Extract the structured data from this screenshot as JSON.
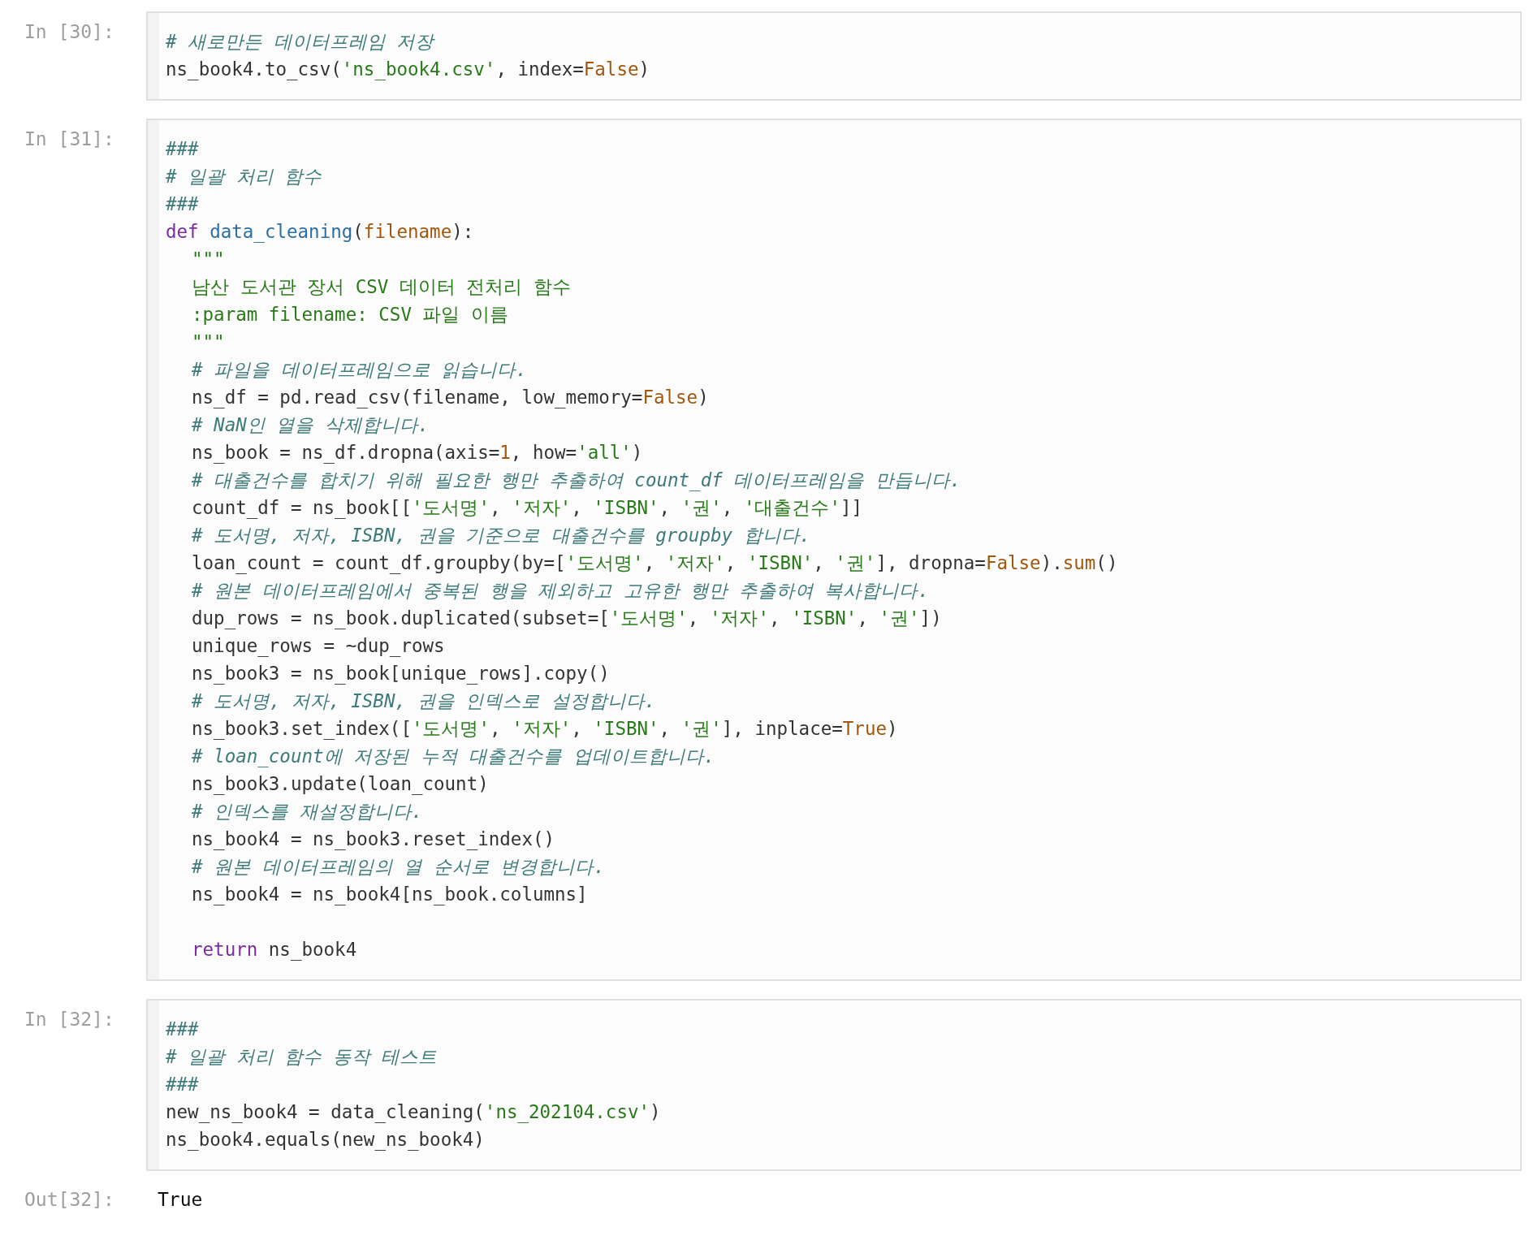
{
  "cells": [
    {
      "prompt": "In [30]:",
      "lines": [
        {
          "tokens": [
            {
              "kind": "comment",
              "text": "# 새로만든 데이터프레임 저장"
            }
          ]
        },
        {
          "tokens": [
            {
              "kind": "plain",
              "text": "ns_book4.to_csv("
            },
            {
              "kind": "string",
              "text": "'ns_book4.csv'"
            },
            {
              "kind": "plain",
              "text": ", index="
            },
            {
              "kind": "constant",
              "text": "False"
            },
            {
              "kind": "plain",
              "text": ")"
            }
          ]
        }
      ]
    },
    {
      "prompt": "In [31]:",
      "lines": [
        {
          "tokens": [
            {
              "kind": "comment",
              "text": "###"
            }
          ]
        },
        {
          "tokens": [
            {
              "kind": "comment",
              "text": "# 일괄 처리 함수"
            }
          ]
        },
        {
          "tokens": [
            {
              "kind": "comment",
              "text": "###"
            }
          ]
        },
        {
          "tokens": [
            {
              "kind": "keyword",
              "text": "def "
            },
            {
              "kind": "function",
              "text": "data_cleaning"
            },
            {
              "kind": "plain",
              "text": "("
            },
            {
              "kind": "constant",
              "text": "filename"
            },
            {
              "kind": "plain",
              "text": "):"
            }
          ],
          "children": [
            {
              "tokens": [
                {
                  "kind": "string",
                  "text": "\"\"\""
                }
              ]
            },
            {
              "tokens": [
                {
                  "kind": "string",
                  "text": "남산 도서관 장서 CSV 데이터 전처리 함수"
                }
              ]
            },
            {
              "tokens": [
                {
                  "kind": "string",
                  "text": ":param filename: CSV 파일 이름"
                }
              ]
            },
            {
              "tokens": [
                {
                  "kind": "string",
                  "text": "\"\"\""
                }
              ]
            },
            {
              "tokens": [
                {
                  "kind": "comment",
                  "text": "# 파일을 데이터프레임으로 읽습니다."
                }
              ]
            },
            {
              "tokens": [
                {
                  "kind": "plain",
                  "text": "ns_df = pd.read_csv(filename, low_memory="
                },
                {
                  "kind": "constant",
                  "text": "False"
                },
                {
                  "kind": "plain",
                  "text": ")"
                }
              ]
            },
            {
              "tokens": [
                {
                  "kind": "comment",
                  "text": "# NaN인 열을 삭제합니다."
                }
              ]
            },
            {
              "tokens": [
                {
                  "kind": "plain",
                  "text": "ns_book = ns_df.dropna(axis="
                },
                {
                  "kind": "constant",
                  "text": "1"
                },
                {
                  "kind": "plain",
                  "text": ", how="
                },
                {
                  "kind": "string",
                  "text": "'all'"
                },
                {
                  "kind": "plain",
                  "text": ")"
                }
              ]
            },
            {
              "tokens": [
                {
                  "kind": "comment",
                  "text": "# 대출건수를 합치기 위해 필요한 행만 추출하여 count_df 데이터프레임을 만듭니다."
                }
              ]
            },
            {
              "tokens": [
                {
                  "kind": "plain",
                  "text": "count_df = ns_book[["
                },
                {
                  "kind": "string",
                  "text": "'도서명'"
                },
                {
                  "kind": "plain",
                  "text": ", "
                },
                {
                  "kind": "string",
                  "text": "'저자'"
                },
                {
                  "kind": "plain",
                  "text": ", "
                },
                {
                  "kind": "string",
                  "text": "'ISBN'"
                },
                {
                  "kind": "plain",
                  "text": ", "
                },
                {
                  "kind": "string",
                  "text": "'권'"
                },
                {
                  "kind": "plain",
                  "text": ", "
                },
                {
                  "kind": "string",
                  "text": "'대출건수'"
                },
                {
                  "kind": "plain",
                  "text": "]]"
                }
              ]
            },
            {
              "tokens": [
                {
                  "kind": "comment",
                  "text": "# 도서명, 저자, ISBN, 권을 기준으로 대출건수를 groupby 합니다."
                }
              ]
            },
            {
              "tokens": [
                {
                  "kind": "plain",
                  "text": "loan_count = count_df.groupby(by=["
                },
                {
                  "kind": "string",
                  "text": "'도서명'"
                },
                {
                  "kind": "plain",
                  "text": ", "
                },
                {
                  "kind": "string",
                  "text": "'저자'"
                },
                {
                  "kind": "plain",
                  "text": ", "
                },
                {
                  "kind": "string",
                  "text": "'ISBN'"
                },
                {
                  "kind": "plain",
                  "text": ", "
                },
                {
                  "kind": "string",
                  "text": "'권'"
                },
                {
                  "kind": "plain",
                  "text": "], dropna="
                },
                {
                  "kind": "constant",
                  "text": "False"
                },
                {
                  "kind": "plain",
                  "text": ")."
                },
                {
                  "kind": "constant",
                  "text": "sum"
                },
                {
                  "kind": "plain",
                  "text": "()"
                }
              ]
            },
            {
              "tokens": [
                {
                  "kind": "comment",
                  "text": "# 원본 데이터프레임에서 중복된 행을 제외하고 고유한 행만 추출하여 복사합니다."
                }
              ]
            },
            {
              "tokens": [
                {
                  "kind": "plain",
                  "text": "dup_rows = ns_book.duplicated(subset=["
                },
                {
                  "kind": "string",
                  "text": "'도서명'"
                },
                {
                  "kind": "plain",
                  "text": ", "
                },
                {
                  "kind": "string",
                  "text": "'저자'"
                },
                {
                  "kind": "plain",
                  "text": ", "
                },
                {
                  "kind": "string",
                  "text": "'ISBN'"
                },
                {
                  "kind": "plain",
                  "text": ", "
                },
                {
                  "kind": "string",
                  "text": "'권'"
                },
                {
                  "kind": "plain",
                  "text": "])"
                }
              ]
            },
            {
              "tokens": [
                {
                  "kind": "plain",
                  "text": "unique_rows = ~dup_rows"
                }
              ]
            },
            {
              "tokens": [
                {
                  "kind": "plain",
                  "text": "ns_book3 = ns_book[unique_rows].copy()"
                }
              ]
            },
            {
              "tokens": [
                {
                  "kind": "comment",
                  "text": "# 도서명, 저자, ISBN, 권을 인덱스로 설정합니다."
                }
              ]
            },
            {
              "tokens": [
                {
                  "kind": "plain",
                  "text": "ns_book3.set_index(["
                },
                {
                  "kind": "string",
                  "text": "'도서명'"
                },
                {
                  "kind": "plain",
                  "text": ", "
                },
                {
                  "kind": "string",
                  "text": "'저자'"
                },
                {
                  "kind": "plain",
                  "text": ", "
                },
                {
                  "kind": "string",
                  "text": "'ISBN'"
                },
                {
                  "kind": "plain",
                  "text": ", "
                },
                {
                  "kind": "string",
                  "text": "'권'"
                },
                {
                  "kind": "plain",
                  "text": "], inplace="
                },
                {
                  "kind": "constant",
                  "text": "True"
                },
                {
                  "kind": "plain",
                  "text": ")"
                }
              ]
            },
            {
              "tokens": [
                {
                  "kind": "comment",
                  "text": "# loan_count에 저장된 누적 대출건수를 업데이트합니다."
                }
              ]
            },
            {
              "tokens": [
                {
                  "kind": "plain",
                  "text": "ns_book3.update(loan_count)"
                }
              ]
            },
            {
              "tokens": [
                {
                  "kind": "comment",
                  "text": "# 인덱스를 재설정합니다."
                }
              ]
            },
            {
              "tokens": [
                {
                  "kind": "plain",
                  "text": "ns_book4 = ns_book3.reset_index()"
                }
              ]
            },
            {
              "tokens": [
                {
                  "kind": "comment",
                  "text": "# 원본 데이터프레임의 열 순서로 변경합니다."
                }
              ]
            },
            {
              "tokens": [
                {
                  "kind": "plain",
                  "text": "ns_book4 = ns_book4[ns_book.columns]"
                }
              ]
            },
            {
              "blank_before": true,
              "tokens": [
                {
                  "kind": "keyword",
                  "text": "return"
                },
                {
                  "kind": "plain",
                  "text": " ns_book4"
                }
              ]
            }
          ]
        }
      ]
    },
    {
      "prompt": "In [32]:",
      "lines": [
        {
          "tokens": [
            {
              "kind": "comment",
              "text": "###"
            }
          ]
        },
        {
          "tokens": [
            {
              "kind": "comment",
              "text": "# 일괄 처리 함수 동작 테스트"
            }
          ]
        },
        {
          "tokens": [
            {
              "kind": "comment",
              "text": "###"
            }
          ]
        },
        {
          "tokens": [
            {
              "kind": "plain",
              "text": "new_ns_book4 = data_cleaning("
            },
            {
              "kind": "string",
              "text": "'ns_202104.csv'"
            },
            {
              "kind": "plain",
              "text": ")"
            }
          ]
        },
        {
          "tokens": [
            {
              "kind": "plain",
              "text": "ns_book4.equals(new_ns_book4)"
            }
          ]
        }
      ],
      "output": {
        "prompt": "Out[32]:",
        "text": "True"
      }
    }
  ]
}
